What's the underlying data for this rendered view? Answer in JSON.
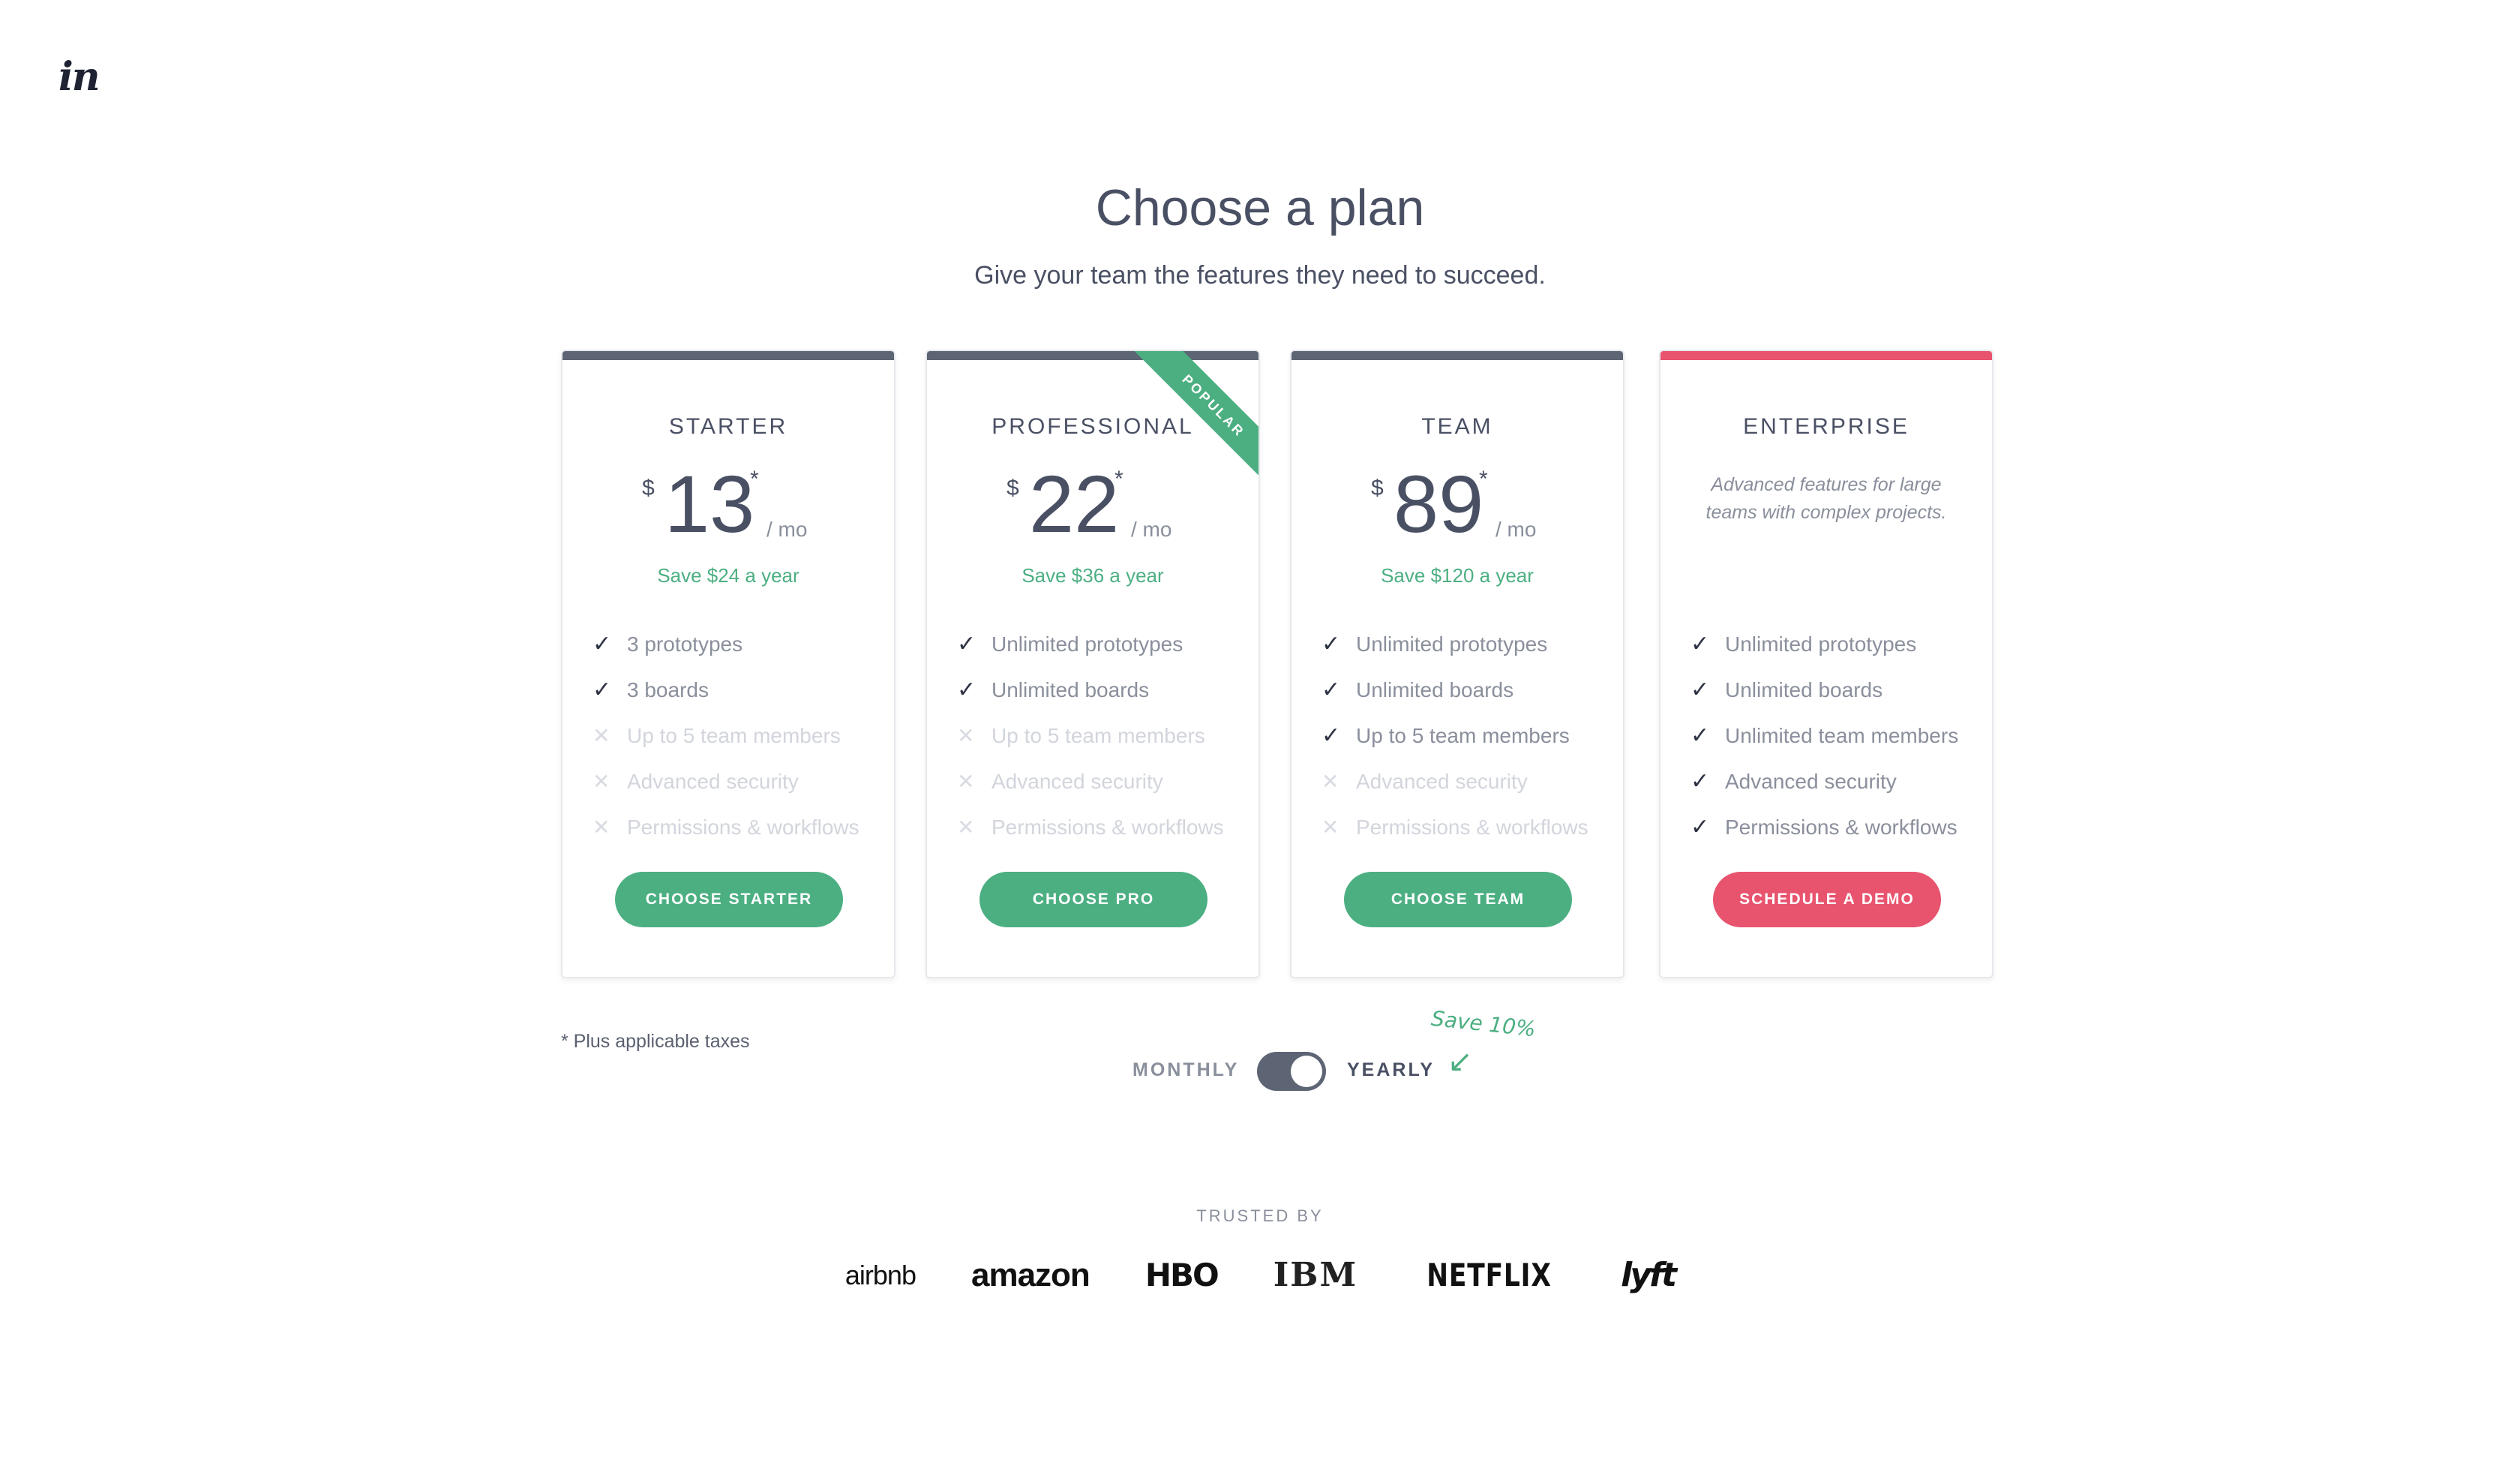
{
  "logo": "in",
  "header": {
    "title": "Choose a plan",
    "subtitle": "Give your team the features they need to succeed."
  },
  "plans": [
    {
      "name": "STARTER",
      "currency": "$",
      "price": "13",
      "asterisk": "*",
      "period": "/ mo",
      "save": "Save $24 a year",
      "features": [
        "3 prototypes",
        "3 boards",
        "Up to 5 team members",
        "Advanced security",
        "Permissions & workflows"
      ],
      "included": [
        true,
        true,
        false,
        false,
        false
      ],
      "cta": "CHOOSE STARTER"
    },
    {
      "name": "PROFESSIONAL",
      "badge": "POPULAR",
      "currency": "$",
      "price": "22",
      "asterisk": "*",
      "period": "/ mo",
      "save": "Save $36 a year",
      "features": [
        "Unlimited prototypes",
        "Unlimited boards",
        "Up to 5 team members",
        "Advanced security",
        "Permissions & workflows"
      ],
      "included": [
        true,
        true,
        false,
        false,
        false
      ],
      "cta": "CHOOSE PRO"
    },
    {
      "name": "TEAM",
      "currency": "$",
      "price": "89",
      "asterisk": "*",
      "period": "/ mo",
      "save": "Save $120 a year",
      "features": [
        "Unlimited prototypes",
        "Unlimited boards",
        "Up to 5 team members",
        "Advanced security",
        "Permissions & workflows"
      ],
      "included": [
        true,
        true,
        true,
        false,
        false
      ],
      "cta": "CHOOSE TEAM"
    },
    {
      "name": "ENTERPRISE",
      "description": "Advanced features for large teams with complex projects.",
      "features": [
        "Unlimited prototypes",
        "Unlimited boards",
        "Unlimited team members",
        "Advanced security",
        "Permissions & workflows"
      ],
      "included": [
        true,
        true,
        true,
        true,
        true
      ],
      "cta": "SCHEDULE A DEMO"
    }
  ],
  "footnote": "* Plus applicable taxes",
  "billing": {
    "monthly_label": "MONTHLY",
    "yearly_label": "YEARLY",
    "selected": "yearly",
    "save_note": "Save 10%"
  },
  "trusted": {
    "label": "TRUSTED BY",
    "logos": [
      "airbnb",
      "amazon",
      "HBO",
      "IBM",
      "NETFLIX",
      "lyft"
    ]
  },
  "colors": {
    "green": "#4caf82",
    "red": "#e8536e",
    "dark": "#5d6474",
    "text": "#4a5064"
  },
  "icons": {
    "included": "check-icon",
    "excluded": "cross-icon"
  }
}
